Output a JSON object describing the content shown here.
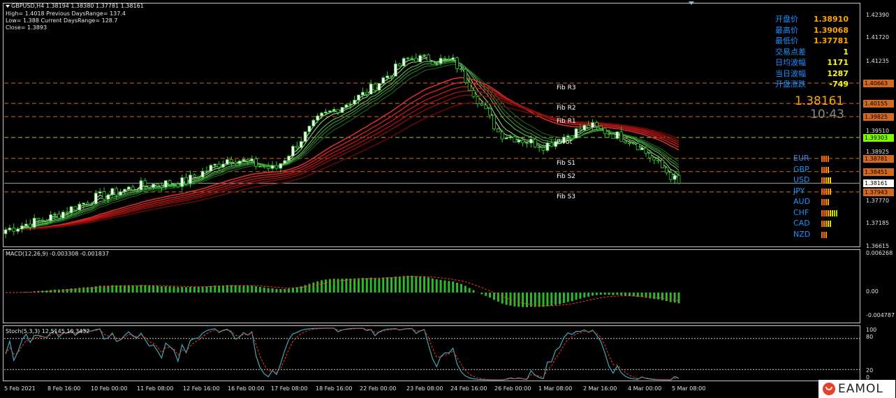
{
  "header": {
    "symbol_line": "GBPUSD,H4  1.38194 1.38380 1.37781 1.38161",
    "line2": "High= 1.4018 Previous DaysRange= 137.4",
    "line3": "Low= 1.388 Current DaysRange= 128.7",
    "line4": "Close= 1.3893"
  },
  "info_panel": [
    {
      "label": "开盘价",
      "value": "1.38910",
      "color": "#ffa500"
    },
    {
      "label": "最高价",
      "value": "1.39068",
      "color": "#ffa500"
    },
    {
      "label": "最低价",
      "value": "1.37781",
      "color": "#ffa500"
    },
    {
      "label": "交易点差",
      "value": "1",
      "color": "#ffff00"
    },
    {
      "label": "日均波幅",
      "value": "1171",
      "color": "#ffff00"
    },
    {
      "label": "当日波幅",
      "value": "1287",
      "color": "#ffff00"
    },
    {
      "label": "开盘涨跌",
      "value": "-749",
      "color": "#ffff00"
    }
  ],
  "big_price": "1.38161",
  "big_time": "10:43",
  "currencies": [
    {
      "name": "EUR",
      "bars": [
        "#ff6a00",
        "#ff6a00",
        "#ff6a00",
        "#ff6a00"
      ]
    },
    {
      "name": "GBP",
      "bars": [
        "#ff6a00",
        "#ff6a00",
        "#ff8c00",
        "#ffa500"
      ]
    },
    {
      "name": "USD",
      "bars": [
        "#ff6a00",
        "#ff8c00",
        "#ffa500",
        "#ffd000",
        "#ffd000"
      ]
    },
    {
      "name": "JPY",
      "bars": [
        "#ff6a00",
        "#ff6a00",
        "#ff8c00",
        "#ff8c00",
        "#ffa500"
      ]
    },
    {
      "name": "AUD",
      "bars": [
        "#ff6a00",
        "#ff6a00",
        "#ff8c00",
        "#ffa500"
      ]
    },
    {
      "name": "CHF",
      "bars": [
        "#ff6a00",
        "#ff6a00",
        "#ff8c00",
        "#ffa500",
        "#ffd000",
        "#d4e000",
        "#a8d800",
        "#a8d800"
      ]
    },
    {
      "name": "CAD",
      "bars": [
        "#ff6a00",
        "#ff8c00",
        "#ffa500",
        "#ffd000",
        "#d4e000"
      ]
    },
    {
      "name": "NZD",
      "bars": [
        "#ff6a00",
        "#ff6a00",
        "#ff8c00"
      ]
    }
  ],
  "price_axis": [
    "1.42390",
    "1.41720",
    "1.41235",
    "1.40663",
    "1.40155",
    "1.39825",
    "1.39510",
    "1.39303",
    "1.38925",
    "1.38781",
    "1.38451",
    "1.38161",
    "1.37943",
    "1.37770",
    "1.37185",
    "1.36615"
  ],
  "price_tags": [
    {
      "value": "1.40663",
      "color": "#d2691e"
    },
    {
      "value": "1.40155",
      "color": "#d2691e"
    },
    {
      "value": "1.39825",
      "color": "#d2691e"
    },
    {
      "value": "1.39303",
      "color": "#7cfc00"
    },
    {
      "value": "1.38781",
      "color": "#d2691e"
    },
    {
      "value": "1.38451",
      "color": "#d2691e"
    },
    {
      "value": "1.38161",
      "color": "#ffffff"
    },
    {
      "value": "1.37943",
      "color": "#d2691e"
    }
  ],
  "fib_levels": [
    {
      "label": "Fib R3",
      "price": 1.40663,
      "color": "#d2691e"
    },
    {
      "label": "Fib R2",
      "price": 1.40155,
      "color": "#d2691e"
    },
    {
      "label": "Fib R1",
      "price": 1.39825,
      "color": "#d2691e"
    },
    {
      "label": "Pivot",
      "price": 1.39303,
      "color": "#9acd32"
    },
    {
      "label": "Fib S1",
      "price": 1.38781,
      "color": "#d2691e"
    },
    {
      "label": "Fib S2",
      "price": 1.38451,
      "color": "#d2691e"
    },
    {
      "label": "Fib S3",
      "price": 1.37943,
      "color": "#d2691e"
    }
  ],
  "macd": {
    "title": "MACD(12,26,9) -0.003308 -0.001837",
    "axis": [
      "0.006268",
      "0.00",
      "-0.004787"
    ]
  },
  "stoch": {
    "title": "Stoch(5,3,3) 12.5145 10.3432",
    "axis": [
      "100",
      "80",
      "20",
      "0"
    ]
  },
  "dates": [
    "5 Feb 2021",
    "8 Feb 16:00",
    "10 Feb 00:00",
    "11 Feb 08:00",
    "12 Feb 16:00",
    "16 Feb 00:00",
    "17 Feb 08:00",
    "18 Feb 16:00",
    "22 Feb 00:00",
    "23 Feb 08:00",
    "24 Feb 16:00",
    "26 Feb 00:00",
    "1 Mar 08:00",
    "2 Mar 16:00",
    "4 Mar 00:00",
    "5 Mar 08:00"
  ],
  "logo": "EAMOL",
  "chart_data": {
    "type": "line",
    "title": "GBPUSD,H4",
    "ylim": [
      1.36615,
      1.4239
    ],
    "x": [
      "5 Feb 2021",
      "8 Feb 16:00",
      "10 Feb 00:00",
      "11 Feb 08:00",
      "12 Feb 16:00",
      "16 Feb 00:00",
      "17 Feb 08:00",
      "18 Feb 16:00",
      "22 Feb 00:00",
      "23 Feb 08:00",
      "24 Feb 16:00",
      "26 Feb 00:00",
      "1 Mar 08:00",
      "2 Mar 16:00",
      "4 Mar 00:00",
      "5 Mar 08:00"
    ],
    "series": [
      {
        "values": [
          1.37,
          1.373,
          1.378,
          1.381,
          1.382,
          1.388,
          1.385,
          1.398,
          1.404,
          1.413,
          1.412,
          1.394,
          1.391,
          1.396,
          1.392,
          1.3816
        ]
      }
    ]
  }
}
